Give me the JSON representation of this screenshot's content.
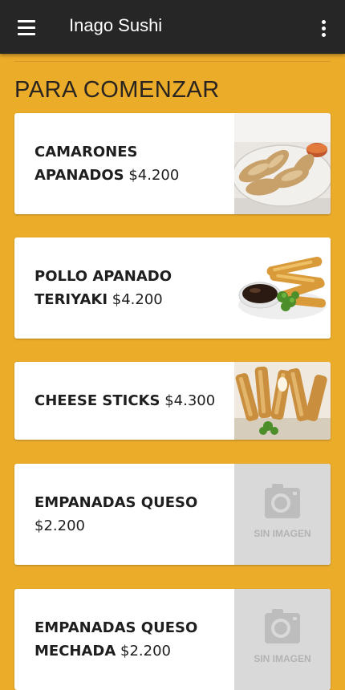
{
  "appbar": {
    "title": "Inago Sushi"
  },
  "section": {
    "title": "PARA COMENZAR"
  },
  "items": [
    {
      "name": "CAMARONES APANADOS",
      "price": "$4.200",
      "image": "fried-shrimp-photo"
    },
    {
      "name": "POLLO APANADO TERIYAKI",
      "price": "$4.200",
      "image": "fried-chicken-teriyaki-photo"
    },
    {
      "name": "CHEESE STICKS",
      "price": "$4.300",
      "image": "cheese-sticks-photo"
    },
    {
      "name": "EMPANADAS QUESO",
      "price": "$2.200",
      "image": "no-image-placeholder",
      "image_label": "SIN IMAGEN"
    },
    {
      "name": "EMPANADAS QUESO MECHADA",
      "price": "$2.200",
      "image": "no-image-placeholder",
      "image_label": "SIN IMAGEN"
    }
  ],
  "icons": {
    "menu": "hamburger-menu-icon",
    "overflow": "more-vert-icon",
    "placeholder": "camera-icon"
  },
  "colors": {
    "background": "#ebac2a",
    "appbar": "#262626",
    "card": "#ffffff",
    "placeholder": "#d9d9d9"
  }
}
